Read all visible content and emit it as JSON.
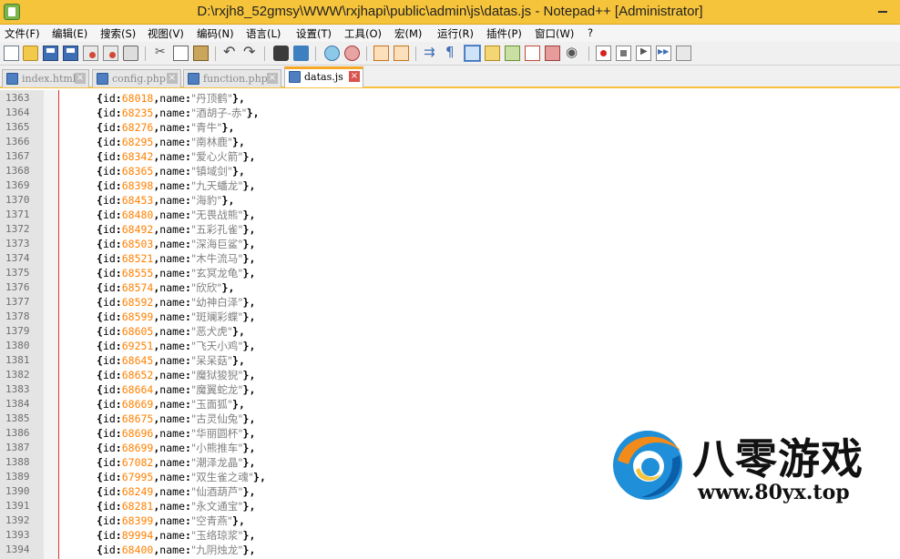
{
  "window": {
    "title": "D:\\rxjh8_52gmsy\\WWW\\rxjhapi\\public\\admin\\js\\datas.js - Notepad++ [Administrator]"
  },
  "menu": [
    "文件(F)",
    "编辑(E)",
    "搜索(S)",
    "视图(V)",
    "编码(N)",
    "语言(L)",
    "设置(T)",
    "工具(O)",
    "宏(M)",
    "运行(R)",
    "插件(P)",
    "窗口(W)",
    "?"
  ],
  "toolbar": {
    "buttons": [
      {
        "icon": "new-file-icon"
      },
      {
        "icon": "open-file-icon"
      },
      {
        "icon": "save-icon"
      },
      {
        "icon": "save-all-icon"
      },
      {
        "icon": "close-icon"
      },
      {
        "icon": "close-all-icon"
      },
      {
        "icon": "print-icon"
      },
      {
        "icon": "cut-icon"
      },
      {
        "icon": "copy-icon"
      },
      {
        "icon": "paste-icon"
      },
      {
        "icon": "undo-icon"
      },
      {
        "icon": "redo-icon"
      },
      {
        "icon": "find-icon"
      },
      {
        "icon": "replace-icon"
      },
      {
        "icon": "zoom-in-icon"
      },
      {
        "icon": "zoom-out-icon"
      },
      {
        "icon": "sync-vertical-icon"
      },
      {
        "icon": "sync-horizontal-icon"
      },
      {
        "icon": "word-wrap-icon"
      },
      {
        "icon": "show-all-chars-icon"
      },
      {
        "icon": "indent-guide-icon"
      },
      {
        "icon": "user-defined-language-icon"
      },
      {
        "icon": "document-map-icon"
      },
      {
        "icon": "function-list-icon"
      },
      {
        "icon": "folder-as-workspace-icon"
      },
      {
        "icon": "monitoring-icon"
      },
      {
        "icon": "record-macro-icon"
      },
      {
        "icon": "stop-recording-icon"
      },
      {
        "icon": "playback-icon"
      },
      {
        "icon": "run-macro-multiple-icon"
      },
      {
        "icon": "save-macro-icon"
      }
    ]
  },
  "tabs": [
    {
      "label": "index.html",
      "active": false
    },
    {
      "label": "config.php",
      "active": false
    },
    {
      "label": "function.php",
      "active": false
    },
    {
      "label": "datas.js",
      "active": true
    }
  ],
  "editor": {
    "lines": [
      {
        "n": "1363",
        "id": "68018",
        "name": "丹顶鹤",
        "tail": "},"
      },
      {
        "n": "1364",
        "id": "68235",
        "name": "酒胡子-赤",
        "tail": "},"
      },
      {
        "n": "1365",
        "id": "68276",
        "name": "青牛",
        "tail": "},"
      },
      {
        "n": "1366",
        "id": "68295",
        "name": "南林鹿",
        "tail": "},"
      },
      {
        "n": "1367",
        "id": "68342",
        "name": "爱心火箭",
        "tail": "},"
      },
      {
        "n": "1368",
        "id": "68365",
        "name": "镇域剑",
        "tail": "},"
      },
      {
        "n": "1369",
        "id": "68398",
        "name": "九天蟠龙",
        "tail": "},"
      },
      {
        "n": "1370",
        "id": "68453",
        "name": "海豹",
        "tail": "},"
      },
      {
        "n": "1371",
        "id": "68480",
        "name": "无畏战熊",
        "tail": "},"
      },
      {
        "n": "1372",
        "id": "68492",
        "name": "五彩孔雀",
        "tail": "},"
      },
      {
        "n": "1373",
        "id": "68503",
        "name": "深海巨鲨",
        "tail": "},"
      },
      {
        "n": "1374",
        "id": "68521",
        "name": "木牛流马",
        "tail": "},"
      },
      {
        "n": "1375",
        "id": "68555",
        "name": "玄冥龙龟",
        "tail": "},"
      },
      {
        "n": "1376",
        "id": "68574",
        "name": "欣欣",
        "tail": "},"
      },
      {
        "n": "1377",
        "id": "68592",
        "name": "幼神白泽",
        "tail": "},"
      },
      {
        "n": "1378",
        "id": "68599",
        "name": "斑斓彩蝶",
        "tail": "},"
      },
      {
        "n": "1379",
        "id": "68605",
        "name": "恶犬虎",
        "tail": "},"
      },
      {
        "n": "1380",
        "id": "69251",
        "name": "飞天小鸡",
        "tail": "},"
      },
      {
        "n": "1381",
        "id": "68645",
        "name": "呆呆菇",
        "tail": "},"
      },
      {
        "n": "1382",
        "id": "68652",
        "name": "魔狱狻猊",
        "tail": "},"
      },
      {
        "n": "1383",
        "id": "68664",
        "name": "魔翼蛇龙",
        "tail": "},"
      },
      {
        "n": "1384",
        "id": "68669",
        "name": "玉面狐",
        "tail": "},"
      },
      {
        "n": "1385",
        "id": "68675",
        "name": "古灵仙兔",
        "tail": "},"
      },
      {
        "n": "1386",
        "id": "68696",
        "name": "华丽圆杯",
        "tail": "},"
      },
      {
        "n": "1387",
        "id": "68699",
        "name": "小熊推车",
        "tail": "},"
      },
      {
        "n": "1388",
        "id": "67082",
        "name": "潮泽龙晶",
        "tail": "},"
      },
      {
        "n": "1389",
        "id": "67995",
        "name": "双生雀之魂",
        "tail": "},"
      },
      {
        "n": "1390",
        "id": "68249",
        "name": "仙酒葫芦",
        "tail": "},"
      },
      {
        "n": "1391",
        "id": "68281",
        "name": "永文通宝",
        "tail": "},"
      },
      {
        "n": "1392",
        "id": "68399",
        "name": "空青燕",
        "tail": "},"
      },
      {
        "n": "1393",
        "id": "89994",
        "name": "玉络琼浆",
        "tail": "},"
      },
      {
        "n": "1394",
        "id": "68400",
        "name": "九阴烛龙",
        "tail": "},"
      }
    ]
  },
  "watermark": {
    "name": "八零游戏",
    "url": "www.80yx.top"
  },
  "colors": {
    "titlebar": "#f6c43a",
    "active_tab_accent": "#f9a825",
    "number": "#ff8000",
    "string": "#808080",
    "edge_line": "#e03030"
  }
}
